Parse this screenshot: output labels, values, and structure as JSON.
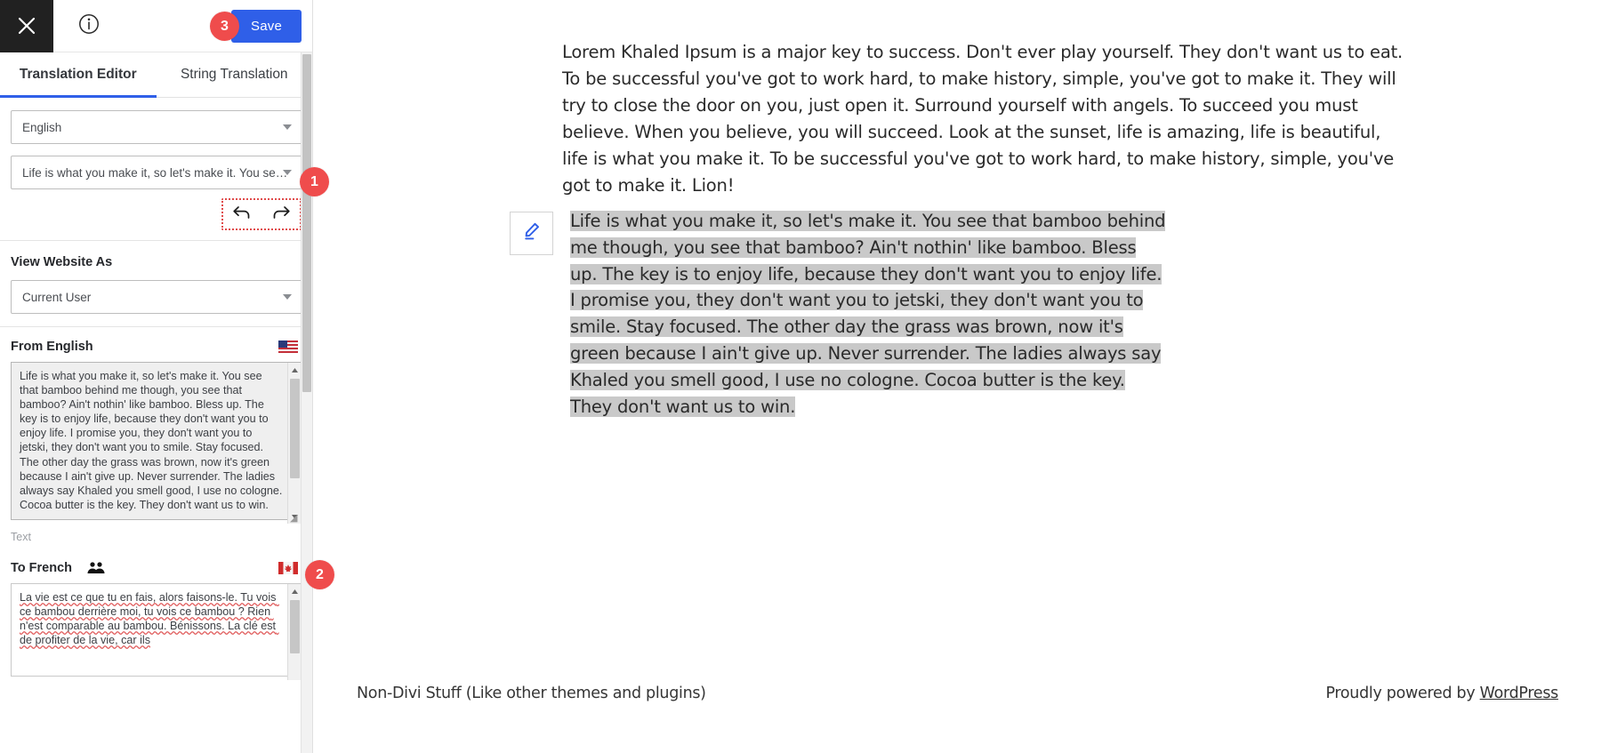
{
  "topbar": {
    "close_icon": "close-icon",
    "info_icon": "info-icon",
    "save_label": "Save"
  },
  "badges": {
    "one": "1",
    "two": "2",
    "three": "3"
  },
  "tabs": [
    {
      "label": "Translation Editor",
      "active": true
    },
    {
      "label": "String Translation",
      "active": false
    }
  ],
  "selects": {
    "language": {
      "value": "English",
      "caret_icon": "chevron-down-icon"
    },
    "string": {
      "value": "Life is what you make it, so let's make it. You se…",
      "caret_icon": "chevron-down-icon"
    }
  },
  "history": {
    "undo_icon": "undo-arrow-icon",
    "redo_icon": "redo-arrow-icon"
  },
  "view_website_as": {
    "title": "View Website As",
    "value": "Current User",
    "caret_icon": "chevron-down-icon"
  },
  "source": {
    "title": "From English",
    "flag_icon": "us-flag-icon",
    "value": "Life is what you make it, so let's make it. You see that bamboo behind me though, you see that bamboo? Ain't nothin' like bamboo. Bless up. The key is to enjoy life, because they don't want you to enjoy life. I promise you, they don't want you to jetski, they don't want you to smile. Stay focused. The other day the grass was brown, now it's green because I ain't give up. Never surrender. The ladies always say Khaled you smell good, I use no cologne. Cocoa butter is the key. They don't want us to win.",
    "caption": "Text"
  },
  "target": {
    "title": "To French",
    "people_icon": "people-icon",
    "flag_icon": "ca-flag-icon",
    "value": "La vie est ce que tu en fais, alors faisons-le. Tu vois ce bambou derrière moi, tu vois ce bambou ? Rien n'est comparable au bambou. Bénissons. La clé est de profiter de la vie, car ils"
  },
  "main": {
    "paragraph": "Lorem Khaled Ipsum is a major key to success. Don't ever play yourself. They don't want us to eat. To be successful you've got to work hard, to make history, simple, you've got to make it. They will try to close the door on you, just open it. Surround yourself with angels. To succeed you must believe. When you believe, you will succeed. Look at the sunset, life is amazing, life is beautiful, life is what you make it. To be successful you've got to work hard, to make history, simple, you've got to make it. Lion!",
    "edit_icon": "pencil-edit-icon",
    "highlighted_paragraph": "Life is what you make it, so let's make it. You see that bamboo behind me though, you see that bamboo? Ain't nothin' like bamboo. Bless up. The key is to enjoy life, because they don't want you to enjoy life. I promise you, they don't want you to jetski, they don't want you to smile. Stay focused. The other day the grass was brown, now it's green because I ain't give up. Never surrender. The ladies always say Khaled you smell good, I use no cologne. Cocoa butter is the key. They don't want us to win."
  },
  "footer": {
    "left": "Non-Divi Stuff (Like other themes and plugins)",
    "right_prefix": "Proudly powered by ",
    "right_link": "WordPress"
  },
  "colors": {
    "accent": "#2f5fe8",
    "badge": "#ef4c4c",
    "dark": "#212121",
    "highlight": "#c9c9c9"
  }
}
